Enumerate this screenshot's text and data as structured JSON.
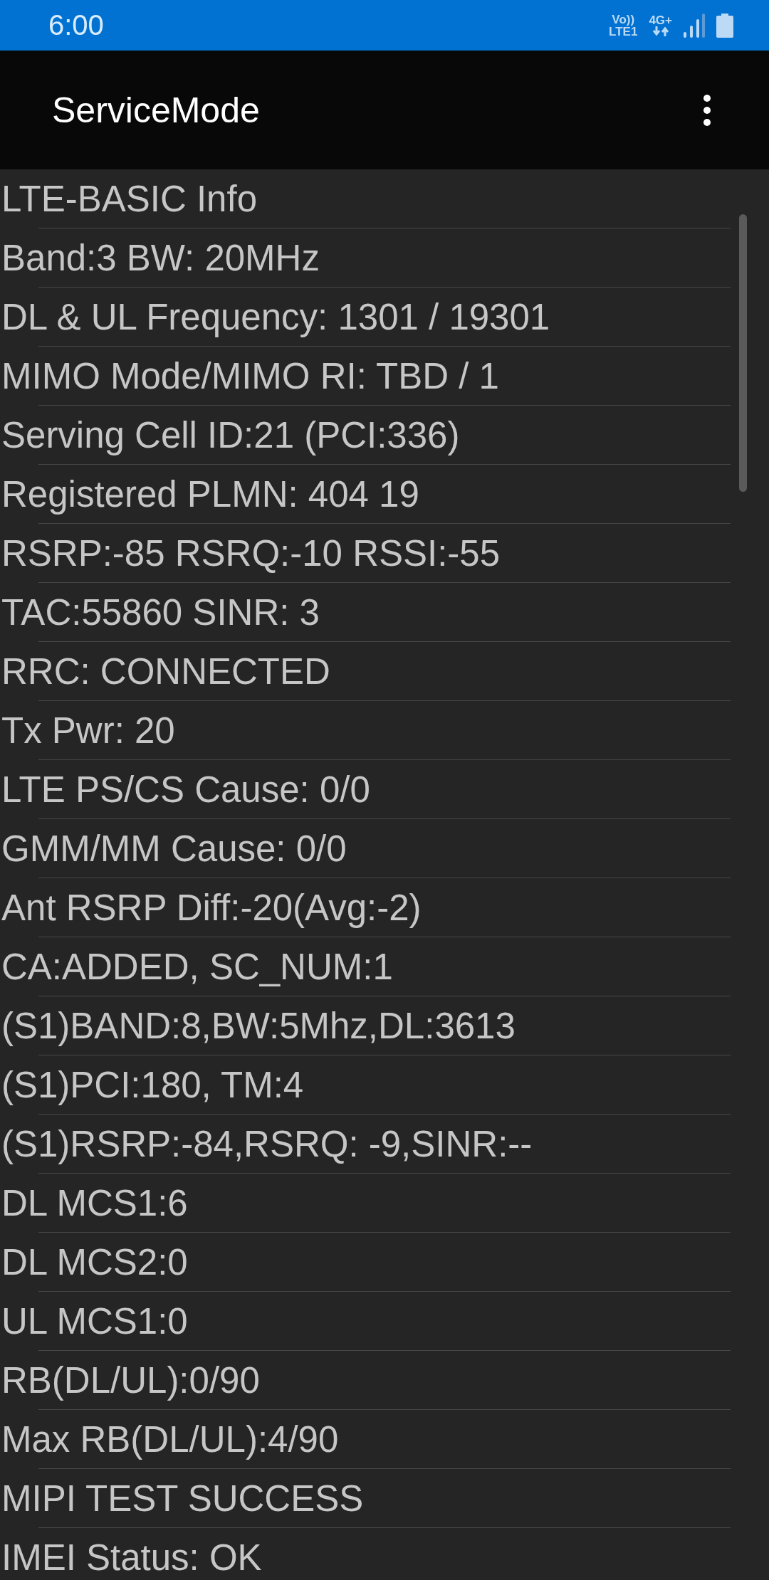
{
  "status_bar": {
    "time": "6:00",
    "volte_label": "Vo))",
    "lte_label": "LTE1",
    "network_type": "4G+"
  },
  "toolbar": {
    "title": "ServiceMode"
  },
  "lines": [
    "LTE-BASIC Info",
    "Band:3 BW: 20MHz",
    "DL & UL Frequency: 1301 / 19301",
    "MIMO Mode/MIMO RI: TBD / 1",
    "Serving Cell ID:21 (PCI:336)",
    "Registered PLMN: 404 19",
    "RSRP:-85 RSRQ:-10 RSSI:-55",
    "TAC:55860 SINR: 3",
    "RRC: CONNECTED",
    "Tx Pwr: 20",
    "LTE PS/CS Cause: 0/0",
    "GMM/MM Cause: 0/0",
    "Ant RSRP Diff:-20(Avg:-2)",
    "CA:ADDED, SC_NUM:1",
    "(S1)BAND:8,BW:5Mhz,DL:3613",
    "(S1)PCI:180, TM:4",
    "(S1)RSRP:-84,RSRQ: -9,SINR:--",
    "DL MCS1:6",
    "DL MCS2:0",
    "UL MCS1:0",
    "RB(DL/UL):0/90",
    "Max RB(DL/UL):4/90",
    "MIPI TEST SUCCESS",
    "IMEI Status: OK"
  ]
}
